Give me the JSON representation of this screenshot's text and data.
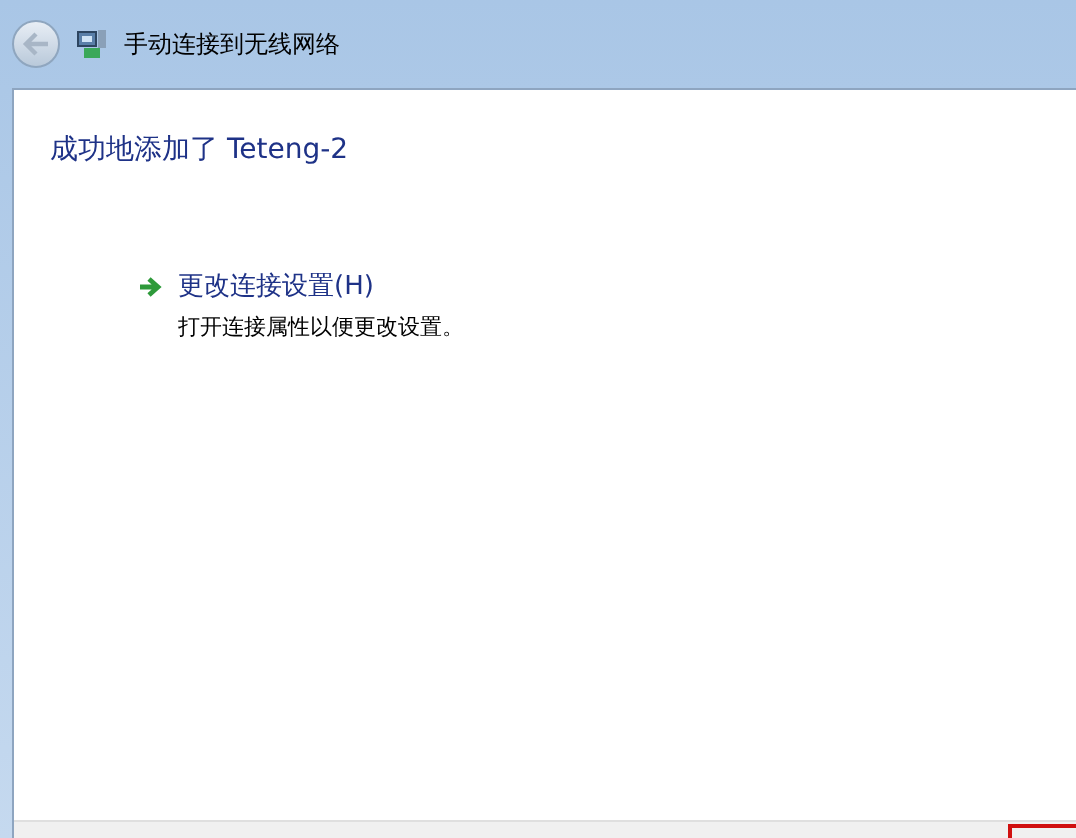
{
  "window": {
    "title": "手动连接到无线网络"
  },
  "heading": "成功地添加了 Teteng-2",
  "tasks": [
    {
      "title": "更改连接设置(H)",
      "description": "打开连接属性以便更改设置。"
    }
  ]
}
